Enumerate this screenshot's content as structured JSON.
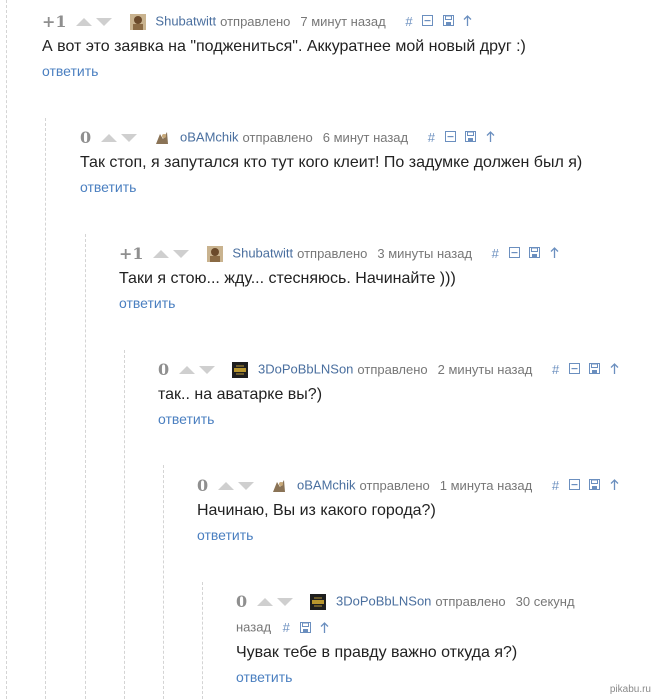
{
  "comments": [
    {
      "rating": "+1",
      "author": "Shubatwitt",
      "sent": "отправлено",
      "time": "7 минут назад",
      "text": "А вот это заявка на \"поджениться\". Аккуратнее мой новый друг :)",
      "reply": "ответить",
      "avatar": "avatar-shubatwitt"
    },
    {
      "rating": "0",
      "author": "oBAMchik",
      "sent": "отправлено",
      "time": "6 минут назад",
      "text": "Так стоп, я запутался кто тут кого клеит! По задумке должен был я)",
      "reply": "ответить",
      "avatar": "avatar-obamchik"
    },
    {
      "rating": "+1",
      "author": "Shubatwitt",
      "sent": "отправлено",
      "time": "3 минуты назад",
      "text": "Таки я стою... жду... стесняюсь. Начинайте )))",
      "reply": "ответить",
      "avatar": "avatar-shubatwitt"
    },
    {
      "rating": "0",
      "author": "3DoPoBbLNSon",
      "sent": "отправлено",
      "time": "2 минуты назад",
      "text": "так.. на аватарке вы?)",
      "reply": "ответить",
      "avatar": "avatar-3dopobblnson"
    },
    {
      "rating": "0",
      "author": "oBAMchik",
      "sent": "отправлено",
      "time": "1 минута назад",
      "text": "Начинаю, Вы из какого города?)",
      "reply": "ответить",
      "avatar": "avatar-obamchik"
    },
    {
      "rating": "0",
      "author": "3DoPoBbLNSon",
      "sent": "отправлено",
      "time_line1": "30 секунд",
      "time_line2": "назад",
      "text": "Чувак тебе в правду важно откуда я?)",
      "reply": "ответить",
      "avatar": "avatar-3dopobblnson"
    }
  ],
  "icons": {
    "hash": "#",
    "link": "hash-link-icon",
    "collapse": "collapse-icon",
    "save": "save-icon",
    "parent": "arrow-up-icon"
  },
  "watermark": "pikabu.ru",
  "colors": {
    "author": "#4a6f9f",
    "link": "#4a7fc0",
    "icon": "#6b8fbf",
    "text": "#222222",
    "muted": "#777777"
  }
}
